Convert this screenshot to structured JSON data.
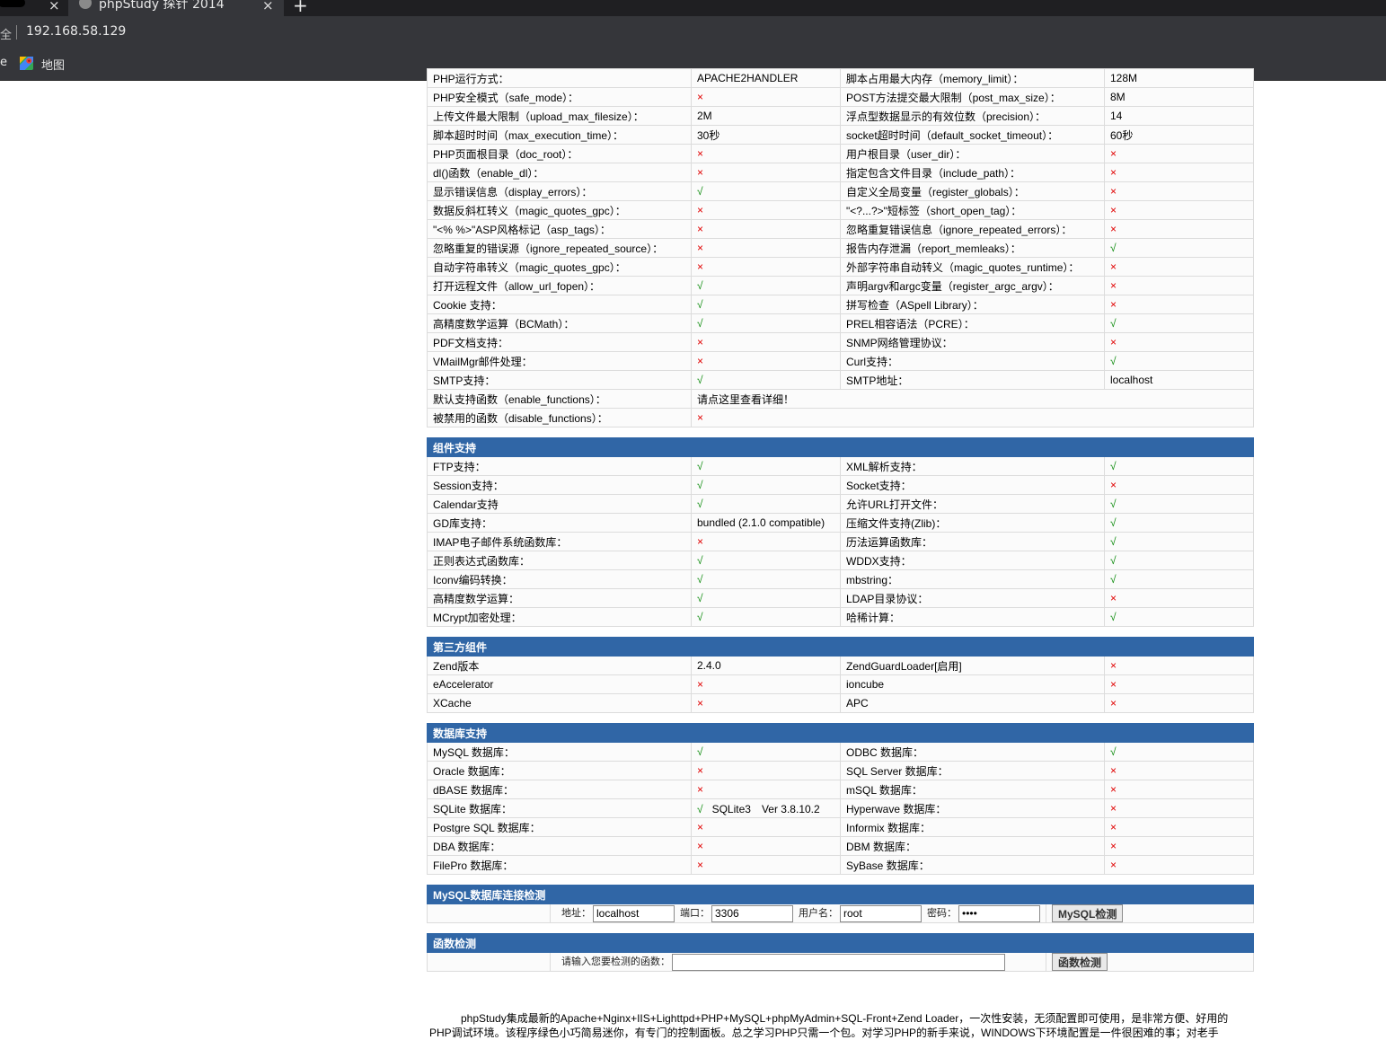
{
  "browser": {
    "prev_tab_close": "×",
    "tab_title": "phpStudy 探针 2014",
    "tab_close": "×",
    "new_tab": "+",
    "secure_label": "全",
    "url": "192.168.58.129",
    "bookmark_prefix": "e",
    "bookmark_label": "地图"
  },
  "basic_rows": [
    [
      "PHP运行方式：",
      "APACHE2HANDLER",
      "脚本占用最大内存（memory_limit）：",
      "128M"
    ],
    [
      "PHP安全模式（safe_mode）：",
      "×",
      "POST方法提交最大限制（post_max_size）：",
      "8M"
    ],
    [
      "上传文件最大限制（upload_max_filesize）：",
      "2M",
      "浮点型数据显示的有效位数（precision）：",
      "14"
    ],
    [
      "脚本超时时间（max_execution_time）：",
      "30秒",
      "socket超时时间（default_socket_timeout）：",
      "60秒"
    ],
    [
      "PHP页面根目录（doc_root）：",
      "×",
      "用户根目录（user_dir）：",
      "×"
    ],
    [
      "dl()函数（enable_dl）：",
      "×",
      "指定包含文件目录（include_path）：",
      "×"
    ],
    [
      "显示错误信息（display_errors）：",
      "√",
      "自定义全局变量（register_globals）：",
      "×"
    ],
    [
      "数据反斜杠转义（magic_quotes_gpc）：",
      "×",
      "\"<?...?>\"短标签（short_open_tag）：",
      "×"
    ],
    [
      "\"<% %>\"ASP风格标记（asp_tags）：",
      "×",
      "忽略重复错误信息（ignore_repeated_errors）：",
      "×"
    ],
    [
      "忽略重复的错误源（ignore_repeated_source）：",
      "×",
      "报告内存泄漏（report_memleaks）：",
      "√"
    ],
    [
      "自动字符串转义（magic_quotes_gpc）：",
      "×",
      "外部字符串自动转义（magic_quotes_runtime）：",
      "×"
    ],
    [
      "打开远程文件（allow_url_fopen）：",
      "√",
      "声明argv和argc变量（register_argc_argv）：",
      "×"
    ],
    [
      "Cookie 支持：",
      "√",
      "拼写检查（ASpell Library）：",
      "×"
    ],
    [
      "高精度数学运算（BCMath）：",
      "√",
      "PREL相容语法（PCRE）：",
      "√"
    ],
    [
      "PDF文档支持：",
      "×",
      "SNMP网络管理协议：",
      "×"
    ],
    [
      "VMailMgr邮件处理：",
      "×",
      "Curl支持：",
      "√"
    ],
    [
      "SMTP支持：",
      "√",
      "SMTP地址：",
      "localhost"
    ]
  ],
  "functions_rows": [
    [
      "默认支持函数（enable_functions）：",
      "请点这里查看详细！"
    ],
    [
      "被禁用的函数（disable_functions）：",
      "×"
    ]
  ],
  "components": {
    "title": "组件支持",
    "rows": [
      [
        "FTP支持：",
        "√",
        "XML解析支持：",
        "√"
      ],
      [
        "Session支持：",
        "√",
        "Socket支持：",
        "×"
      ],
      [
        "Calendar支持",
        "√",
        "允许URL打开文件：",
        "√"
      ],
      [
        "GD库支持：",
        "bundled (2.1.0 compatible)",
        "压缩文件支持(Zlib)：",
        "√"
      ],
      [
        "IMAP电子邮件系统函数库：",
        "×",
        "历法运算函数库：",
        "√"
      ],
      [
        "正则表达式函数库：",
        "√",
        "WDDX支持：",
        "√"
      ],
      [
        "Iconv编码转换：",
        "√",
        "mbstring：",
        "√"
      ],
      [
        "高精度数学运算：",
        "√",
        "LDAP目录协议：",
        "×"
      ],
      [
        "MCrypt加密处理：",
        "√",
        "哈稀计算：",
        "√"
      ]
    ]
  },
  "third_party": {
    "title": "第三方组件",
    "rows": [
      [
        "Zend版本",
        "2.4.0",
        "ZendGuardLoader[启用]",
        "×"
      ],
      [
        "eAccelerator",
        "×",
        "ioncube",
        "×"
      ],
      [
        "XCache",
        "×",
        "APC",
        "×"
      ]
    ]
  },
  "database": {
    "title": "数据库支持",
    "rows": [
      [
        "MySQL 数据库：",
        "√",
        "ODBC 数据库：",
        "√"
      ],
      [
        "Oracle 数据库：",
        "×",
        "SQL Server 数据库：",
        "×"
      ],
      [
        "dBASE 数据库：",
        "×",
        "mSQL 数据库：",
        "×"
      ],
      [
        "SQLite 数据库：",
        "√",
        "Hyperwave 数据库：",
        "×"
      ],
      [
        "Postgre SQL 数据库：",
        "×",
        "Informix 数据库：",
        "×"
      ],
      [
        "DBA 数据库：",
        "×",
        "DBM 数据库：",
        "×"
      ],
      [
        "FilePro 数据库：",
        "×",
        "SyBase 数据库：",
        "×"
      ]
    ],
    "sqlite_version": "SQLite3　Ver 3.8.10.2"
  },
  "mysql_check": {
    "title": "MySQL数据库连接检测",
    "host_label": "地址：",
    "host_value": "localhost",
    "port_label": "端口：",
    "port_value": "3306",
    "user_label": "用户名：",
    "user_value": "root",
    "pass_label": "密码：",
    "pass_value": "root",
    "button": "MySQL检测"
  },
  "func_check": {
    "title": "函数检测",
    "prompt": "请输入您要检测的函数：",
    "value": "",
    "button": "函数检测"
  },
  "footer": "phpStudy集成最新的Apache+Nginx+IIS+Lighttpd+PHP+MySQL+phpMyAdmin+SQL-Front+Zend Loader，一次性安装，无须配置即可使用，是非常方便、好用的PHP调试环境。该程序绿色小巧简易迷你，有专门的控制面板。总之学习PHP只需一个包。对学习PHP的新手来说，WINDOWS下环境配置是一件很困难的事；对老手"
}
